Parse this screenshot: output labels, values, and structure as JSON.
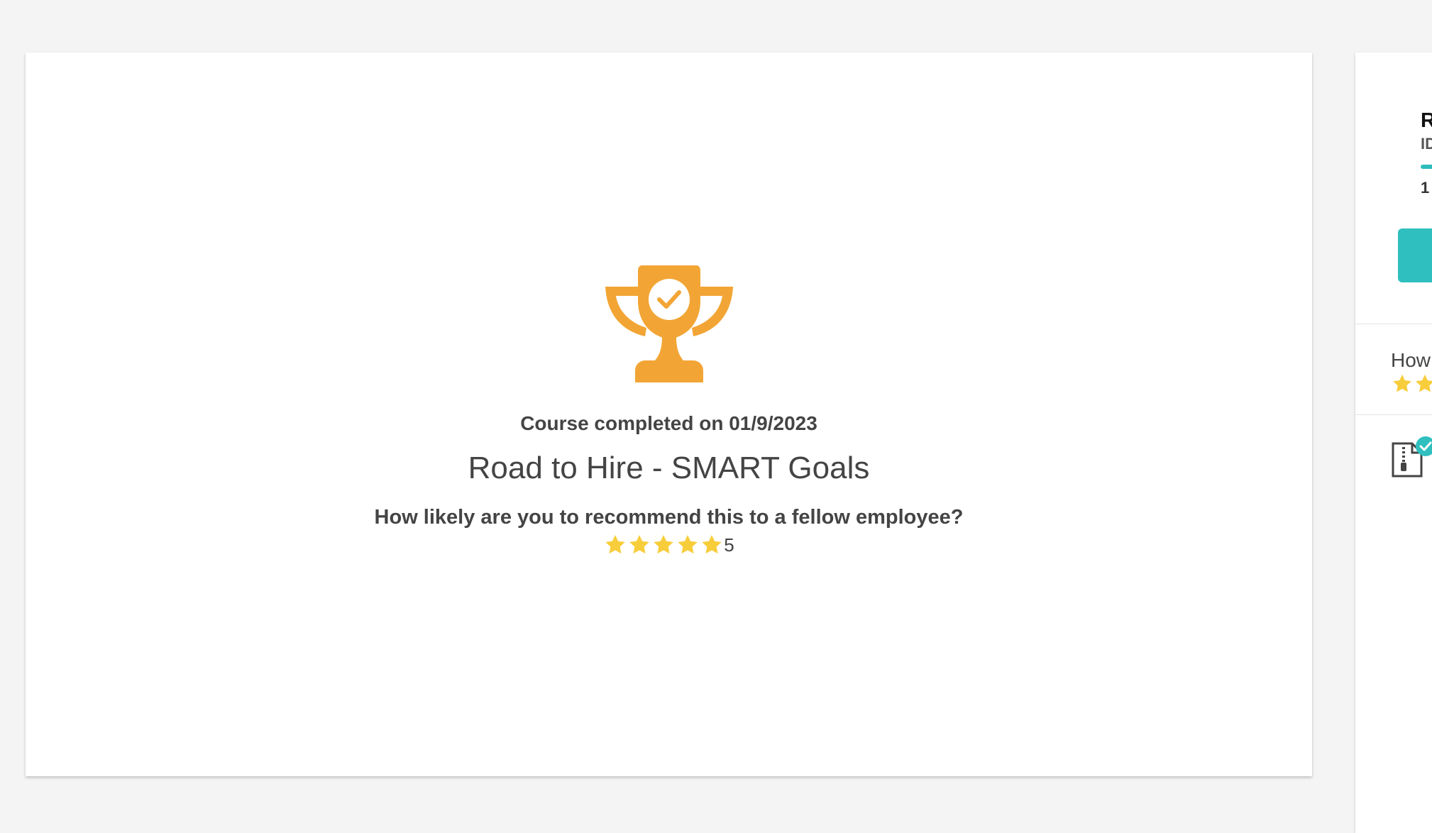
{
  "completion": {
    "icon": "trophy-check-icon",
    "completed_text": "Course completed on 01/9/2023",
    "course_title": "Road to Hire - SMART Goals",
    "rating_question": "How likely are you to recommend this to a fellow employee?",
    "rating_value": "5",
    "rating_stars": 5,
    "rating_max": 5
  },
  "side_panel": {
    "title": "R",
    "subtitle": "ID",
    "progress_label": "1",
    "how_text": "How",
    "file_icon": "zip-file-icon",
    "check_icon": "check-badge-icon"
  },
  "colors": {
    "trophy": "#f2a535",
    "star": "#f7cd3b",
    "accent": "#2fbfbf"
  }
}
